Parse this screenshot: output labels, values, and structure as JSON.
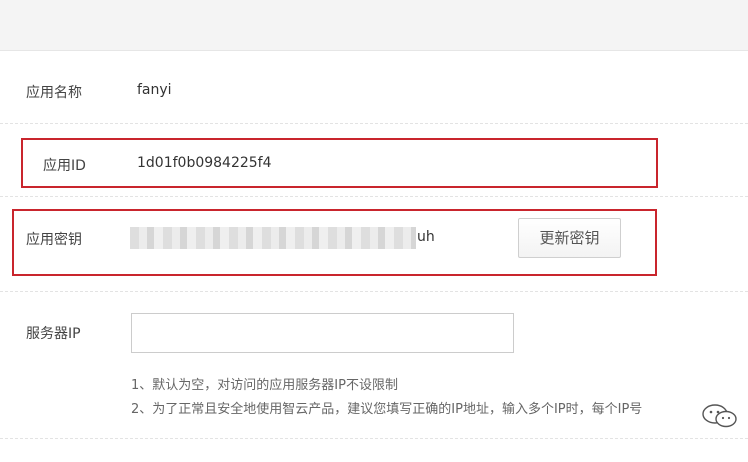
{
  "form": {
    "app_name": {
      "label": "应用名称",
      "value": "fanyi"
    },
    "app_id": {
      "label": "应用ID",
      "value": "1d01f0b0984225f4"
    },
    "app_key": {
      "label": "应用密钥",
      "value_suffix": "uh",
      "refresh_label": "更新密钥"
    },
    "server_ip": {
      "label": "服务器IP",
      "value": "",
      "hints": [
        "1、默认为空，对访问的应用服务器IP不设限制",
        "2、为了正常且安全地使用智云产品，建议您填写正确的IP地址，输入多个IP时，每个IP号"
      ]
    }
  },
  "colors": {
    "highlight": "#c9252d",
    "topbar": "#f4f4f4"
  },
  "icons": [
    "wechat-icon"
  ]
}
